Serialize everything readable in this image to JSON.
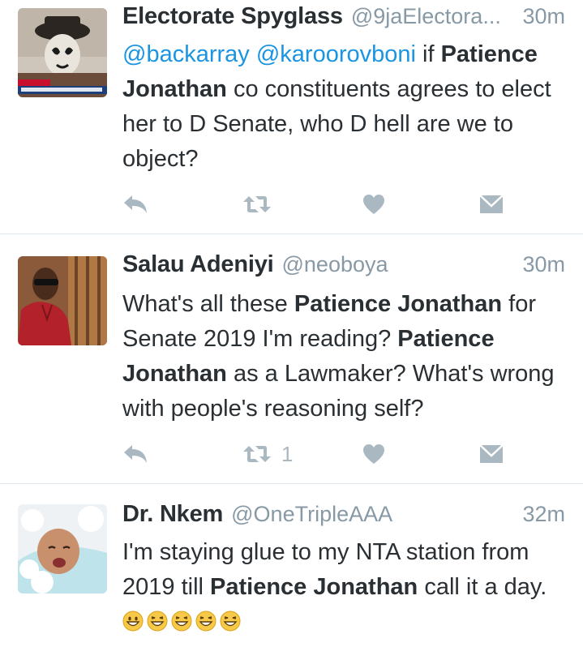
{
  "colors": {
    "link": "#1b95e0",
    "muted": "#8899a6",
    "icon": "#aab8c2",
    "text": "#292f33",
    "divider": "#e1e8ed"
  },
  "tweets": [
    {
      "name": "Electorate Spyglass",
      "handle": "@9jaElectora...",
      "time": "30m",
      "avatar_icon": "masked-face-avatar",
      "text": {
        "mention1": "@backarray",
        "mention2": "@karoorovboni",
        "p1": " if ",
        "bold1": "Patience Jonathan",
        "p2": " co constituents agrees to elect her to D Senate, who D hell are we to object?"
      },
      "retweet_count": ""
    },
    {
      "name": "Salau Adeniyi",
      "handle": "@neoboya",
      "time": "30m",
      "avatar_icon": "man-in-red-shirt-avatar",
      "text": {
        "p1": "What's all these ",
        "bold1": "Patience Jonathan",
        "p2": " for Senate 2019 I'm reading? ",
        "bold2": "Patience Jonathan",
        "p3": " as a Lawmaker? What's wrong with people's reasoning self?"
      },
      "retweet_count": "1"
    },
    {
      "name": "Dr. Nkem",
      "handle": "@OneTripleAAA",
      "time": "32m",
      "avatar_icon": "baby-in-bath-avatar",
      "text": {
        "p1": "I'm staying glue to my NTA station from 2019 till ",
        "bold1": "Patience Jonathan",
        "p2": " call it a day. "
      },
      "emojis": [
        "grinning-face-icon",
        "grinning-squinting-face-icon",
        "grinning-squinting-face-icon",
        "grinning-squinting-face-icon",
        "grinning-squinting-face-icon"
      ]
    }
  ]
}
